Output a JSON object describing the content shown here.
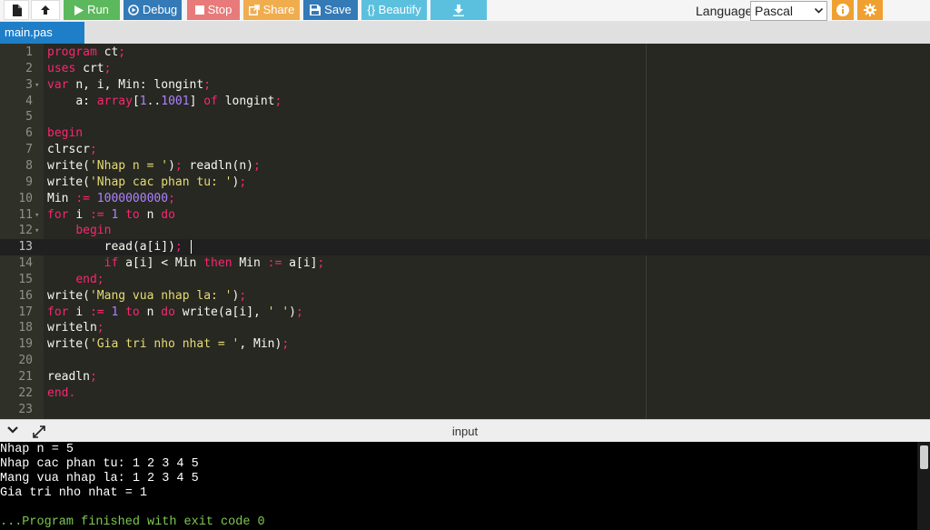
{
  "toolbar": {
    "new_icon": "file-icon",
    "upload_icon": "upload-icon",
    "run": "Run",
    "debug": "Debug",
    "stop": "Stop",
    "share": "Share",
    "save": "Save",
    "beautify": "{} Beautify",
    "download_icon": "download-icon",
    "language_label": "Language",
    "language_value": "Pascal",
    "info_icon": "info-icon",
    "settings_icon": "gear-icon"
  },
  "tab": {
    "filename": "main.pas"
  },
  "editor": {
    "active_line": 13,
    "lines": [
      "program ct;",
      "uses crt;",
      "var n, i, Min: longint;",
      "    a: array[1..1001] of longint;",
      "",
      "begin",
      "clrscr;",
      "write('Nhap n = '); readln(n);",
      "write('Nhap cac phan tu: ');",
      "Min := 1000000000;",
      "for i := 1 to n do",
      "    begin",
      "        read(a[i]);",
      "        if a[i] < Min then Min := a[i];",
      "    end;",
      "write('Mang vua nhap la: ');",
      "for i := 1 to n do write(a[i], ' ');",
      "writeln;",
      "write('Gia tri nho nhat = ', Min);",
      "",
      "readln;",
      "end.",
      ""
    ]
  },
  "io": {
    "title": "input",
    "collapse_icon": "chevron-down-icon",
    "expand_icon": "expand-icon",
    "output": [
      "Nhap n = 5",
      "Nhap cac phan tu: 1 2 3 4 5",
      "Mang vua nhap la: 1 2 3 4 5",
      "Gia tri nho nhat = 1",
      "",
      "...Program finished with exit code 0"
    ]
  },
  "colors": {
    "run": "#5cb85c",
    "debug": "#337ab7",
    "stop": "#e87a7a",
    "share": "#f0ad4e",
    "beautify": "#5bc0de",
    "tab": "#1e7fc8",
    "editor_bg": "#272822",
    "exit_text": "#7ec850"
  }
}
